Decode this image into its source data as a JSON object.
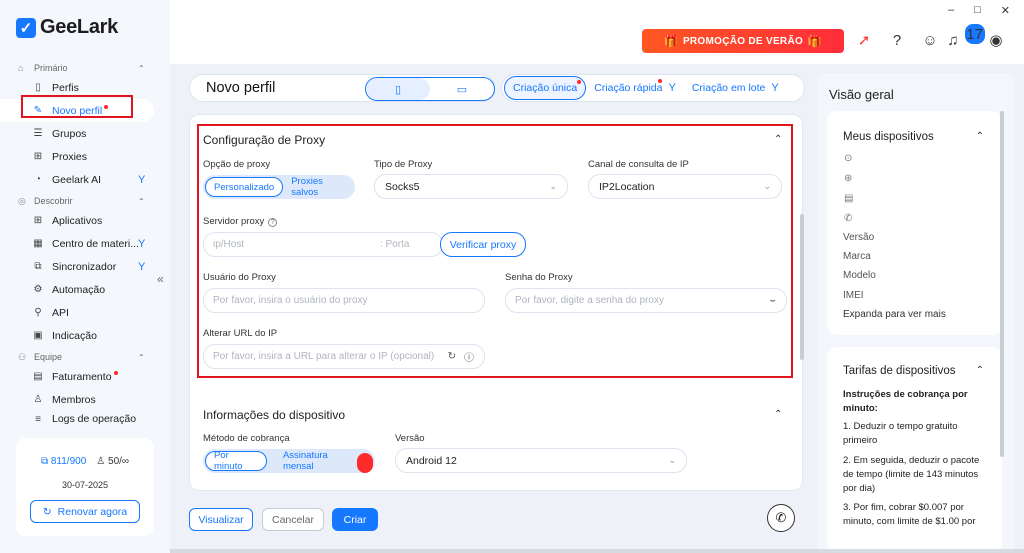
{
  "app": {
    "logo": "GeeLark"
  },
  "window": {
    "minimize": "–",
    "maximize": "□",
    "close": "✕"
  },
  "sidebar": {
    "sections": [
      {
        "label": "Primário",
        "items": [
          {
            "label": "Perfis"
          },
          {
            "label": "Novo perfil",
            "active": true,
            "dot": true
          },
          {
            "label": "Grupos"
          },
          {
            "label": "Proxies"
          },
          {
            "label": "Geelark AI",
            "pin": true
          }
        ]
      },
      {
        "label": "Descobrir",
        "items": [
          {
            "label": "Aplicativos"
          },
          {
            "label": "Centro de materi...",
            "pin": true
          },
          {
            "label": "Sincronizador",
            "pin": true
          },
          {
            "label": "Automação"
          },
          {
            "label": "API"
          },
          {
            "label": "Indicação"
          }
        ]
      },
      {
        "label": "Equipe",
        "items": [
          {
            "label": "Faturamento",
            "dot": true
          },
          {
            "label": "Membros"
          },
          {
            "label": "Logs de operação"
          }
        ]
      }
    ],
    "quota": {
      "profiles": "811/900",
      "members": "50/∞",
      "date": "30-07-2025",
      "renew_label": "Renovar agora"
    }
  },
  "topbar": {
    "promo": "PROMOÇÃO DE VERÃO",
    "notification_count": "17"
  },
  "main": {
    "title": "Novo perfil",
    "modes": {
      "single": "Criação única",
      "quick": "Criação rápida",
      "batch": "Criação em lote"
    },
    "proxy": {
      "title": "Configuração de Proxy",
      "option_label": "Opção de proxy",
      "option_custom": "Personalizado",
      "option_saved": "Proxies salvos",
      "type_label": "Tipo de Proxy",
      "type_value": "Socks5",
      "channel_label": "Canal de consulta de IP",
      "channel_value": "IP2Location",
      "server_label": "Servidor proxy",
      "host_placeholder": "ip/Host",
      "port_placeholder": ": Porta",
      "verify_label": "Verificar proxy",
      "user_label": "Usuário do Proxy",
      "user_placeholder": "Por favor, insira o usuário do proxy",
      "pass_label": "Senha do Proxy",
      "pass_placeholder": "Por favor, digite a senha do proxy",
      "url_label": "Alterar URL do IP",
      "url_placeholder": "Por favor, insira a URL para alterar o IP (opcional)"
    },
    "device": {
      "title": "Informações do dispositivo",
      "billing_label": "Método de cobrança",
      "billing_minute": "Por minuto",
      "billing_monthly": "Assinatura mensal",
      "version_label": "Versão",
      "version_value": "Android 12"
    },
    "footer": {
      "preview": "Visualizar",
      "cancel": "Cancelar",
      "create": "Criar"
    }
  },
  "right": {
    "title": "Visão geral",
    "devices": {
      "title": "Meus dispositivos",
      "fields": [
        "Versão",
        "Marca",
        "Modelo",
        "IMEI"
      ],
      "expand": "Expanda para ver mais"
    },
    "rates": {
      "title": "Tarifas de dispositivos",
      "intro": "Instruções de cobrança por minuto:",
      "steps": [
        "1. Deduzir o tempo gratuito primeiro",
        "2. Em seguida, deduzir o pacote de tempo (limite de 143 minutos por dia)",
        "3. Por fim, cobrar $0.007 por minuto, com limite de $1.00 por"
      ]
    }
  },
  "colors": {
    "accent": "#1677ff",
    "highlight": "#e0141e"
  }
}
